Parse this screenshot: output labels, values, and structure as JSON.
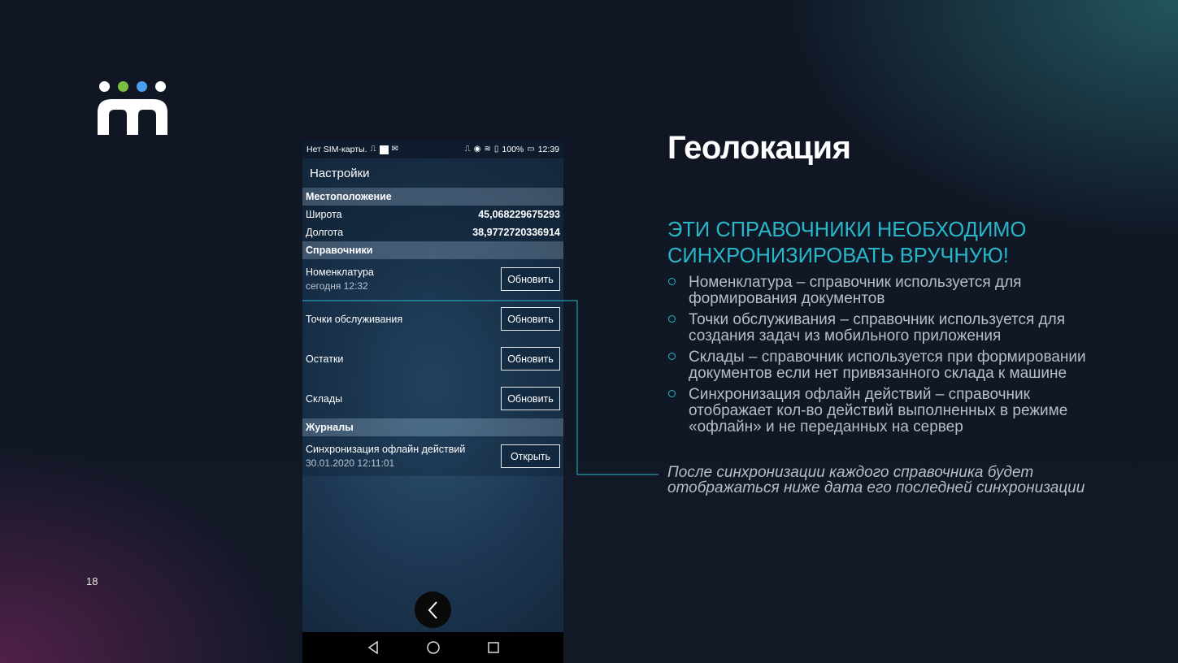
{
  "slide": {
    "page_number": "18"
  },
  "logo": {
    "dot_colors": [
      "#ffffff",
      "#7bc043",
      "#4b9ef0",
      "#ffffff"
    ]
  },
  "phone": {
    "status_bar": {
      "left": "Нет SIM-карты.",
      "battery": "100%",
      "time": "12:39"
    },
    "app_title": "Настройки",
    "location_section": {
      "title": "Местоположение",
      "rows": [
        {
          "label": "Широта",
          "value": "45,068229675293"
        },
        {
          "label": "Долгота",
          "value": "38,9772720336914"
        }
      ]
    },
    "refs_section": {
      "title": "Справочники",
      "rows": [
        {
          "label": "Номенклатура",
          "date": "сегодня 12:32",
          "button": "Обновить"
        },
        {
          "label": "Точки обслуживания",
          "button": "Обновить"
        },
        {
          "label": "Остатки",
          "button": "Обновить"
        },
        {
          "label": "Склады",
          "button": "Обновить"
        }
      ]
    },
    "journals_section": {
      "title": "Журналы",
      "rows": [
        {
          "label": "Синхронизация офлайн действий",
          "date": "30.01.2020 12:11:01",
          "button": "Открыть"
        }
      ]
    }
  },
  "content": {
    "title": "Геолокация",
    "subtitle": "ЭТИ СПРАВОЧНИКИ НЕОБХОДИМО СИНХРОНИЗИРОВАТЬ ВРУЧНУЮ!",
    "bullets": [
      "Номенклатура – справочник используется для формирования документов",
      "Точки обслуживания – справочник используется для создания задач из мобильного приложения",
      "Склады – справочник используется при формировании документов если нет привязанного склада к машине",
      "Синхронизация офлайн действий – справочник отображает кол-во действий выполненных в режиме «офлайн» и не переданных на сервер"
    ],
    "note": "После синхронизации каждого справочника будет отображаться ниже дата его последней  синхронизации"
  },
  "colors": {
    "accent": "#28b7c9",
    "body_text": "#b9bdc4"
  }
}
